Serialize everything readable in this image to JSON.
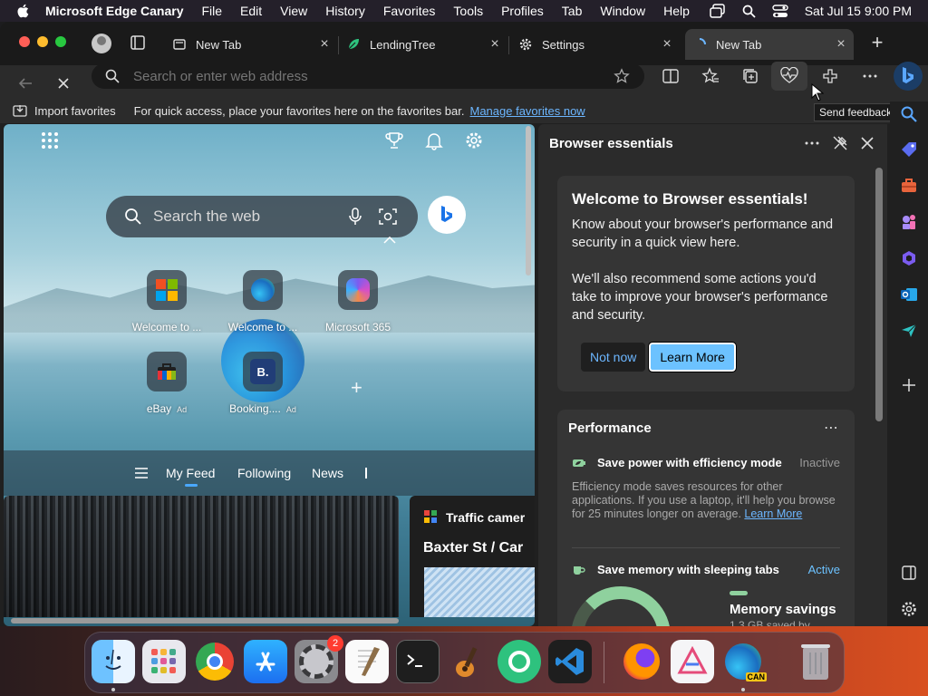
{
  "menubar": {
    "app_name": "Microsoft Edge Canary",
    "items": [
      "File",
      "Edit",
      "View",
      "History",
      "Favorites",
      "Tools",
      "Profiles",
      "Tab",
      "Window",
      "Help"
    ],
    "datetime": "Sat Jul 15  9:00 PM"
  },
  "tabs": [
    {
      "label": "New Tab",
      "icon": "new-tab-icon"
    },
    {
      "label": "LendingTree",
      "icon": "lendingtree-icon"
    },
    {
      "label": "Settings",
      "icon": "gear-icon"
    },
    {
      "label": "New Tab",
      "icon": "loading-icon",
      "active": true
    }
  ],
  "addressbar": {
    "placeholder": "Search or enter web address"
  },
  "favbar": {
    "import_label": "Import favorites",
    "message": "For quick access, place your favorites here on the favorites bar.",
    "manage_link": "Manage favorites now"
  },
  "tooltip": "Send feedback",
  "newtab": {
    "search_placeholder": "Search the web",
    "tiles": [
      {
        "label": "Welcome to ...",
        "icon": "microsoft-icon"
      },
      {
        "label": "Welcome to ...",
        "icon": "edge-icon"
      },
      {
        "label": "Microsoft 365",
        "icon": "m365-icon"
      },
      {
        "label": "eBay",
        "ad": "Ad",
        "icon": "ebay-icon"
      },
      {
        "label": "Booking....",
        "ad": "Ad",
        "icon": "booking-icon",
        "icon_text": "B."
      }
    ],
    "feed_tabs": [
      "My Feed",
      "Following",
      "News"
    ],
    "card2_kicker": "Traffic camer",
    "card2_title": "Baxter St / Car"
  },
  "panel": {
    "title": "Browser essentials",
    "welcome_title": "Welcome to Browser essentials!",
    "welcome_p1": "Know about your browser's performance and security in a quick view here.",
    "welcome_p2": "We'll also recommend some actions you'd take to improve your browser's performance and security.",
    "not_now": "Not now",
    "learn_more": "Learn More",
    "performance_title": "Performance",
    "efficiency_title": "Save power with efficiency mode",
    "efficiency_status": "Inactive",
    "efficiency_desc": "Efficiency mode saves resources for other applications. If you use a laptop, it'll help you browse for 25 minutes longer on average.",
    "efficiency_link": "Learn More",
    "sleeping_title": "Save memory with sleeping tabs",
    "sleeping_status": "Active",
    "memory_label": "Memory savings",
    "memory_sub": "1.3 GB saved by"
  },
  "dock": {
    "settings_badge": "2",
    "edge_canary_label": "CAN"
  },
  "colors": {
    "accent": "#6cc2ff",
    "link": "#6cb6ff",
    "active_green": "#8fd19e"
  }
}
